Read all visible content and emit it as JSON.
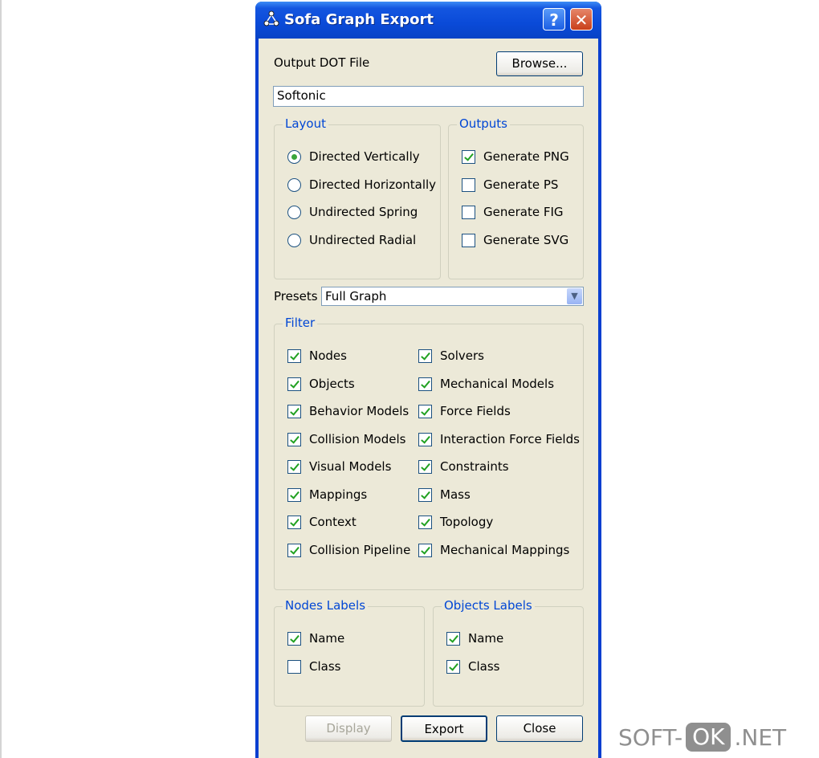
{
  "window": {
    "title": "Sofa Graph Export",
    "help_label": "?",
    "close_label": "✕"
  },
  "output": {
    "label": "Output DOT File",
    "browse_label": "Browse...",
    "file_value": "Softonic"
  },
  "layout": {
    "title": "Layout",
    "options": [
      {
        "label": "Directed Vertically",
        "selected": true
      },
      {
        "label": "Directed Horizontally",
        "selected": false
      },
      {
        "label": "Undirected Spring",
        "selected": false
      },
      {
        "label": "Undirected Radial",
        "selected": false
      }
    ]
  },
  "outputs": {
    "title": "Outputs",
    "items": [
      {
        "label": "Generate PNG",
        "checked": true
      },
      {
        "label": "Generate PS",
        "checked": false
      },
      {
        "label": "Generate FIG",
        "checked": false
      },
      {
        "label": "Generate SVG",
        "checked": false
      }
    ]
  },
  "presets": {
    "label": "Presets",
    "value": "Full Graph",
    "arrow_icon": "chevron-down-icon"
  },
  "filter": {
    "title": "Filter",
    "left": [
      {
        "label": "Nodes",
        "checked": true
      },
      {
        "label": "Objects",
        "checked": true
      },
      {
        "label": "Behavior Models",
        "checked": true
      },
      {
        "label": "Collision Models",
        "checked": true
      },
      {
        "label": "Visual Models",
        "checked": true
      },
      {
        "label": "Mappings",
        "checked": true
      },
      {
        "label": "Context",
        "checked": true
      },
      {
        "label": "Collision Pipeline",
        "checked": true
      }
    ],
    "right": [
      {
        "label": "Solvers",
        "checked": true
      },
      {
        "label": "Mechanical Models",
        "checked": true
      },
      {
        "label": "Force Fields",
        "checked": true
      },
      {
        "label": "Interaction Force Fields",
        "checked": true
      },
      {
        "label": "Constraints",
        "checked": true
      },
      {
        "label": "Mass",
        "checked": true
      },
      {
        "label": "Topology",
        "checked": true
      },
      {
        "label": "Mechanical Mappings",
        "checked": true
      }
    ]
  },
  "nodes_labels": {
    "title": "Nodes Labels",
    "items": [
      {
        "label": "Name",
        "checked": true
      },
      {
        "label": "Class",
        "checked": false
      }
    ]
  },
  "objects_labels": {
    "title": "Objects Labels",
    "items": [
      {
        "label": "Name",
        "checked": true
      },
      {
        "label": "Class",
        "checked": true
      }
    ]
  },
  "buttons": {
    "display": "Display",
    "export": "Export",
    "close": "Close"
  },
  "watermark": {
    "left": "SOFT-",
    "mid": "OK",
    "right": ".NET"
  },
  "colors": {
    "titlebar": "#0a4ad8",
    "dialog_bg": "#ece9d8",
    "group_title": "#0046d5",
    "check": "#21a121"
  }
}
